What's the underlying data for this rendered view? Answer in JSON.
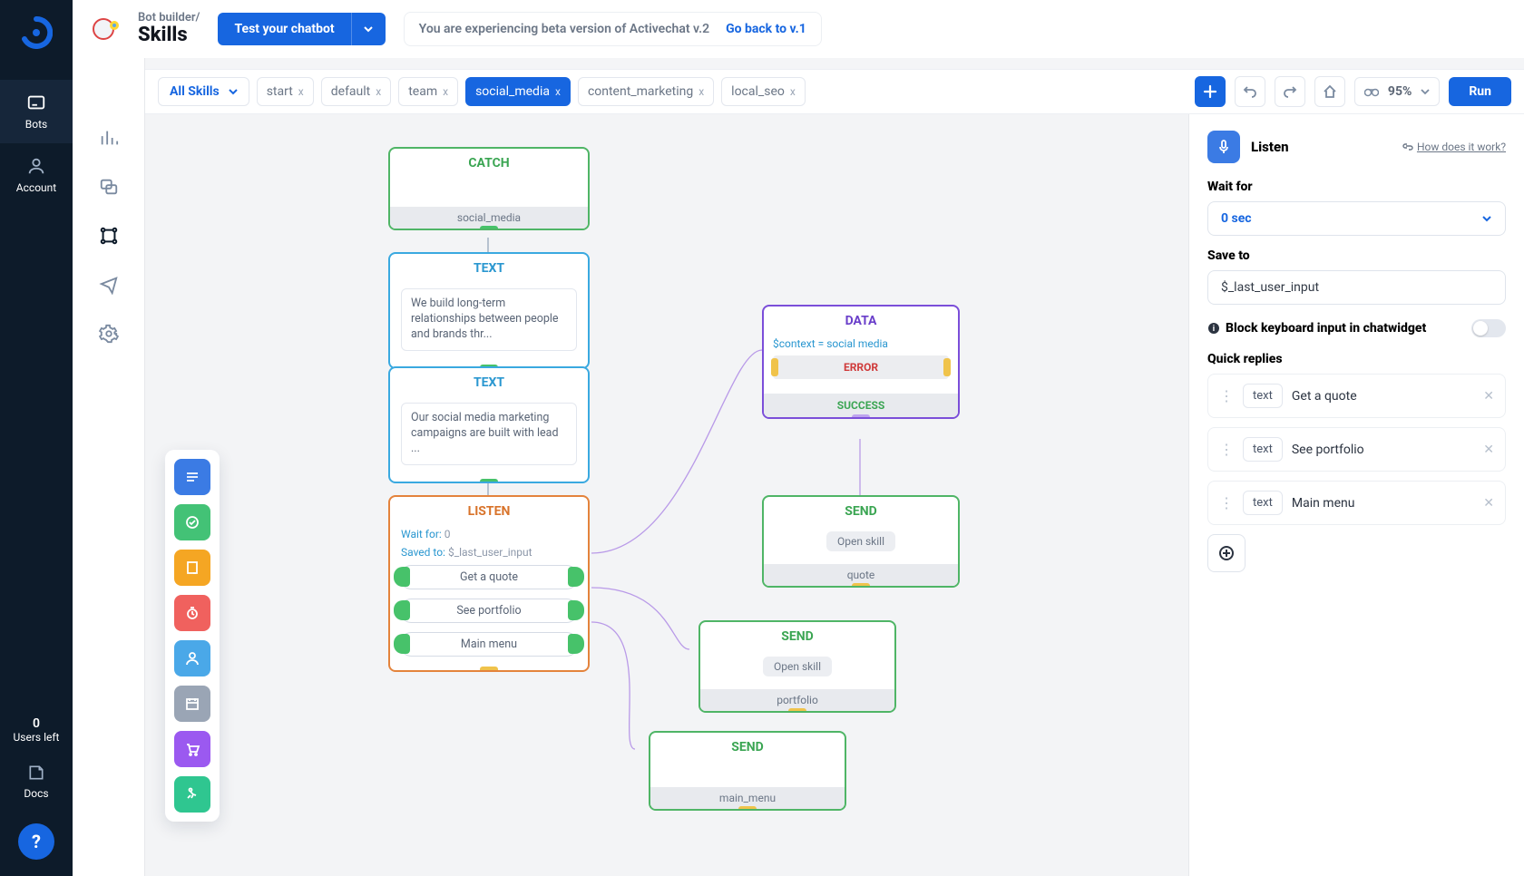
{
  "breadcrumb": {
    "top": "Bot builder/",
    "title": "Skills"
  },
  "header": {
    "test_label": "Test your chatbot",
    "beta_msg": "You are experiencing beta version of Activechat v.2",
    "back_link": "Go back to v.1"
  },
  "dark_nav": {
    "bots": "Bots",
    "account": "Account",
    "users_num": "0",
    "users_label": "Users left",
    "docs": "Docs"
  },
  "tabs": {
    "all": "All Skills",
    "items": [
      "start",
      "default",
      "team",
      "social_media",
      "content_marketing",
      "local_seo"
    ],
    "active_index": 3
  },
  "toolbar": {
    "zoom": "95%",
    "run": "Run"
  },
  "nodes": {
    "catch": {
      "title": "CATCH",
      "footer": "social_media"
    },
    "text1": {
      "title": "TEXT",
      "body": "We build long-term relationships between people and brands thr..."
    },
    "text2": {
      "title": "TEXT",
      "body": "Our social media marketing campaigns are built with lead ..."
    },
    "listen": {
      "title": "LISTEN",
      "wait_k": "Wait for:",
      "wait_v": "0",
      "save_k": "Saved to:",
      "save_v": "$_last_user_input",
      "replies": [
        "Get a quote",
        "See portfolio",
        "Main menu"
      ]
    },
    "data": {
      "title": "DATA",
      "expr": "$context = social media",
      "error": "ERROR",
      "success": "SUCCESS"
    },
    "send1": {
      "title": "SEND",
      "pill": "Open skill",
      "footer": "quote"
    },
    "send2": {
      "title": "SEND",
      "pill": "Open skill",
      "footer": "portfolio"
    },
    "send3": {
      "title": "SEND",
      "footer": "main_menu"
    }
  },
  "panel": {
    "title": "Listen",
    "help": "How does it work?",
    "wait_label": "Wait for",
    "wait_value": "0 sec",
    "save_label": "Save to",
    "save_value": "$_last_user_input",
    "block_label": "Block keyboard input in chatwidget",
    "quick_label": "Quick replies",
    "reply_type": "text",
    "replies": [
      "Get a quote",
      "See portfolio",
      "Main menu"
    ]
  },
  "palette_colors": [
    "#3b7be4",
    "#43c276",
    "#f5a623",
    "#f0615e",
    "#4aa8e8",
    "#9aa5b5",
    "#9b59f0",
    "#2fc690"
  ]
}
